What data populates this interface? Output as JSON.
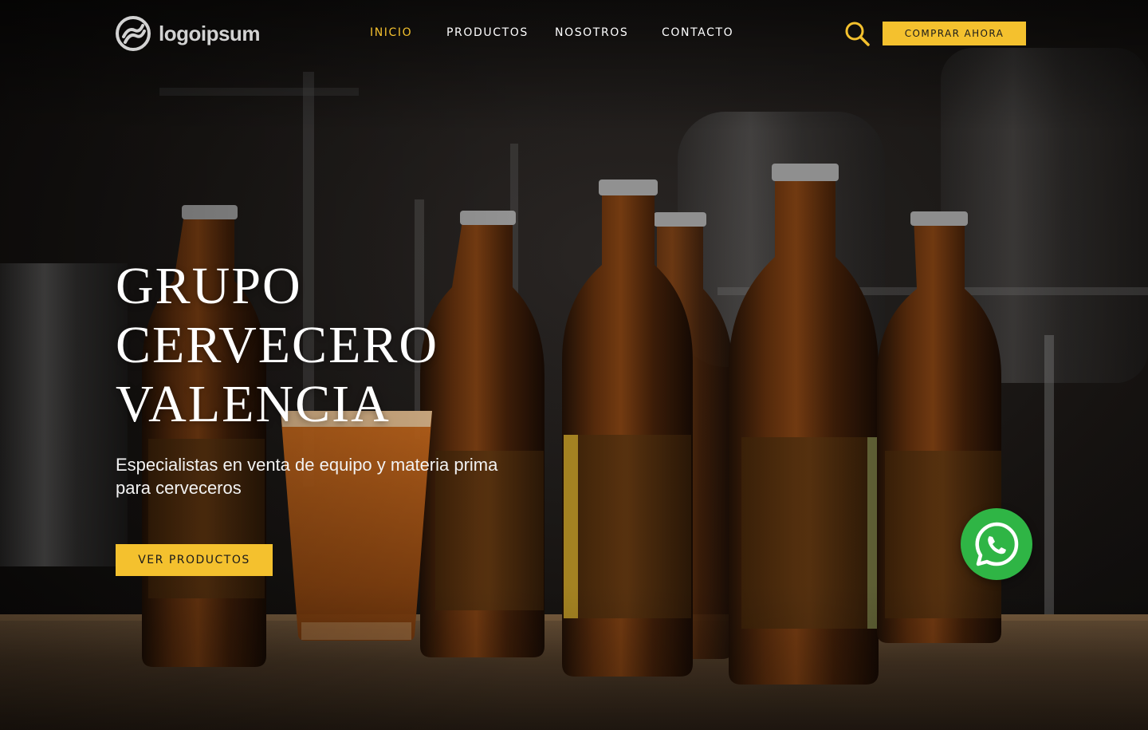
{
  "brand": {
    "logo_text": "logoipsum",
    "logo_icon": "logo-mark-icon"
  },
  "nav": {
    "items": [
      {
        "label": "INICIO",
        "active": true
      },
      {
        "label": "PRODUCTOS",
        "active": false
      },
      {
        "label": "NOSOTROS",
        "active": false
      },
      {
        "label": "CONTACTO",
        "active": false
      }
    ]
  },
  "header": {
    "search_icon": "search-icon",
    "buy_label": "COMPRAR AHORA"
  },
  "hero": {
    "title_lines": [
      "GRUPO",
      "CERVECERO",
      "VALENCIA"
    ],
    "subtitle": "Especialistas en venta de equipo y materia prima para cerveceros",
    "cta_label": "VER PRODUCTOS",
    "background": "beer-bottles-brewery-photo"
  },
  "whatsapp": {
    "icon": "whatsapp-icon"
  },
  "colors": {
    "accent": "#f4c12e",
    "whatsapp": "#2fb545",
    "text": "#ffffff",
    "logo": "#d2d2d2"
  }
}
